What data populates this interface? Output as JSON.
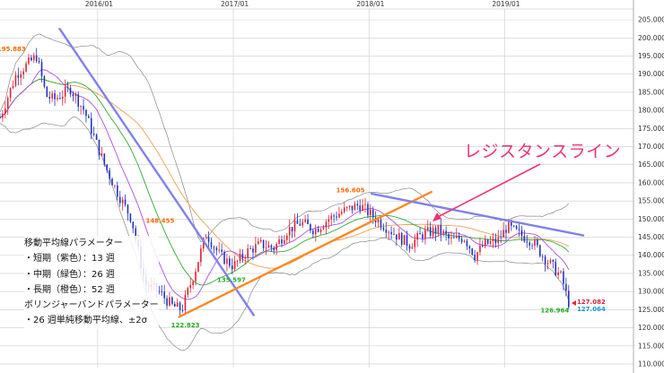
{
  "chart_data": {
    "type": "candlestick",
    "x_ticks": [
      "2016/01",
      "2017/01",
      "2018/01",
      "2019/01"
    ],
    "y_ticks": [
      110,
      115,
      120,
      125,
      130,
      135,
      140,
      145,
      150,
      155,
      160,
      165,
      170,
      175,
      180,
      185,
      190,
      195,
      200,
      205
    ],
    "ylim": [
      109,
      208
    ],
    "price_labels": {
      "high_2015": "195.883",
      "high_2016": "148.455",
      "low_2016": "122.823",
      "low_2017": "135.597",
      "high_2018": "156.605",
      "low_2019": "126.964",
      "last_close": "127.082",
      "last_bid": "127.064"
    },
    "key_points": [
      {
        "label": "195.883",
        "t": 2015.55,
        "y": 195.883
      },
      {
        "label": "148.455",
        "t": 2016.58,
        "y": 148.455
      },
      {
        "label": "122.823",
        "t": 2016.62,
        "y": 122.823
      },
      {
        "label": "135.597",
        "t": 2017.0,
        "y": 135.597
      },
      {
        "label": "156.605",
        "t": 2017.93,
        "y": 156.605
      },
      {
        "label": "126.964",
        "t": 2019.45,
        "y": 126.964
      },
      {
        "label": "127.082",
        "t": 2019.48,
        "y": 127.082
      }
    ],
    "trendlines": [
      {
        "name": "down-trend",
        "color": "#8080ee",
        "from": [
          2015.72,
          202.5
        ],
        "to": [
          2017.15,
          123.5
        ]
      },
      {
        "name": "up-trend",
        "color": "#ff8822",
        "from": [
          2016.6,
          123.0
        ],
        "to": [
          2018.46,
          157.5
        ]
      },
      {
        "name": "resistance-line",
        "color": "#8080ee",
        "from": [
          2018.02,
          157.0
        ],
        "to": [
          2019.58,
          145.5
        ]
      }
    ],
    "series": [
      {
        "name": "短期（紫色）：13 週",
        "color": "#b050e0"
      },
      {
        "name": "中期（緑色）：26 週",
        "color": "#33aa33"
      },
      {
        "name": "長期（橙色）：52 週",
        "color": "#f0a050"
      },
      {
        "name": "26 週単純移動平均線、±2σ",
        "color": "#888888"
      }
    ],
    "colors": {
      "up": "#dd2233",
      "down": "#2233bb",
      "grid": "#cccccc"
    }
  },
  "legend": {
    "title_ma": "移動平均線パラメーター",
    "short": "・短期（紫色）：13 週",
    "mid": "・中期（緑色）：26 週",
    "long": "・長期（橙色）：52 週",
    "title_bb": "ボリンジャーバンドパラメーター",
    "bb": "・26 週単純移動平均線、±2σ"
  },
  "annotation": {
    "resistance_label": "レジスタンスライン"
  }
}
